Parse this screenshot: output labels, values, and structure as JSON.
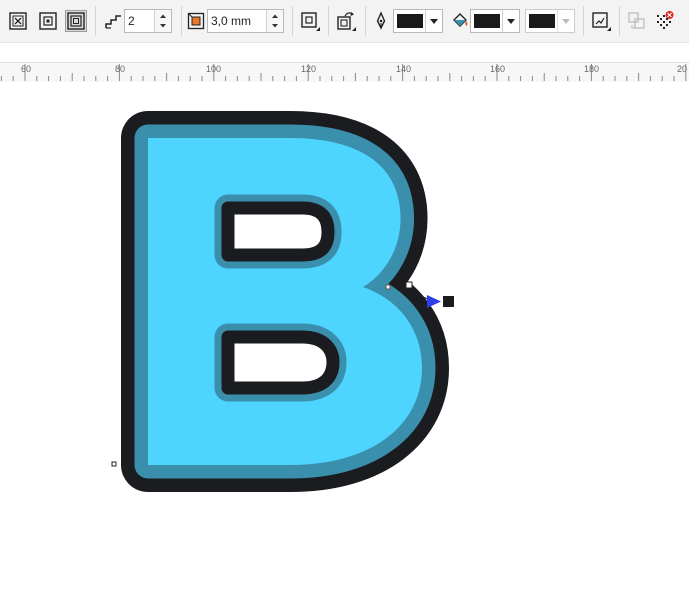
{
  "toolbar": {
    "contour_steps_value": "2",
    "contour_offset_value": "3,0 mm",
    "colors": {
      "outline": "#1a1a1a",
      "fill": "#1a1a1a",
      "accel": "#1a1a1a"
    },
    "icons": [
      "contour-to-center-icon",
      "inside-contour-icon",
      "outside-contour-icon",
      "contour-steps-icon",
      "contour-offset-icon",
      "contour-corners-icon",
      "contour-color-direction-icon",
      "outline-pen-icon",
      "fill-bucket-icon",
      "object-acceleration-icon",
      "copy-contour-properties-icon",
      "clear-contour-icon"
    ]
  },
  "ruler": {
    "labels": [
      "60",
      "80",
      "100",
      "120",
      "140",
      "160",
      "180",
      "20"
    ]
  },
  "document": {
    "letter_colors": {
      "outer_contour": "#1b1c20",
      "middle_contour": "#3a8fac",
      "letter_fill": "#4dd4ff",
      "interactive_arrow": "#2c3fe8"
    }
  }
}
